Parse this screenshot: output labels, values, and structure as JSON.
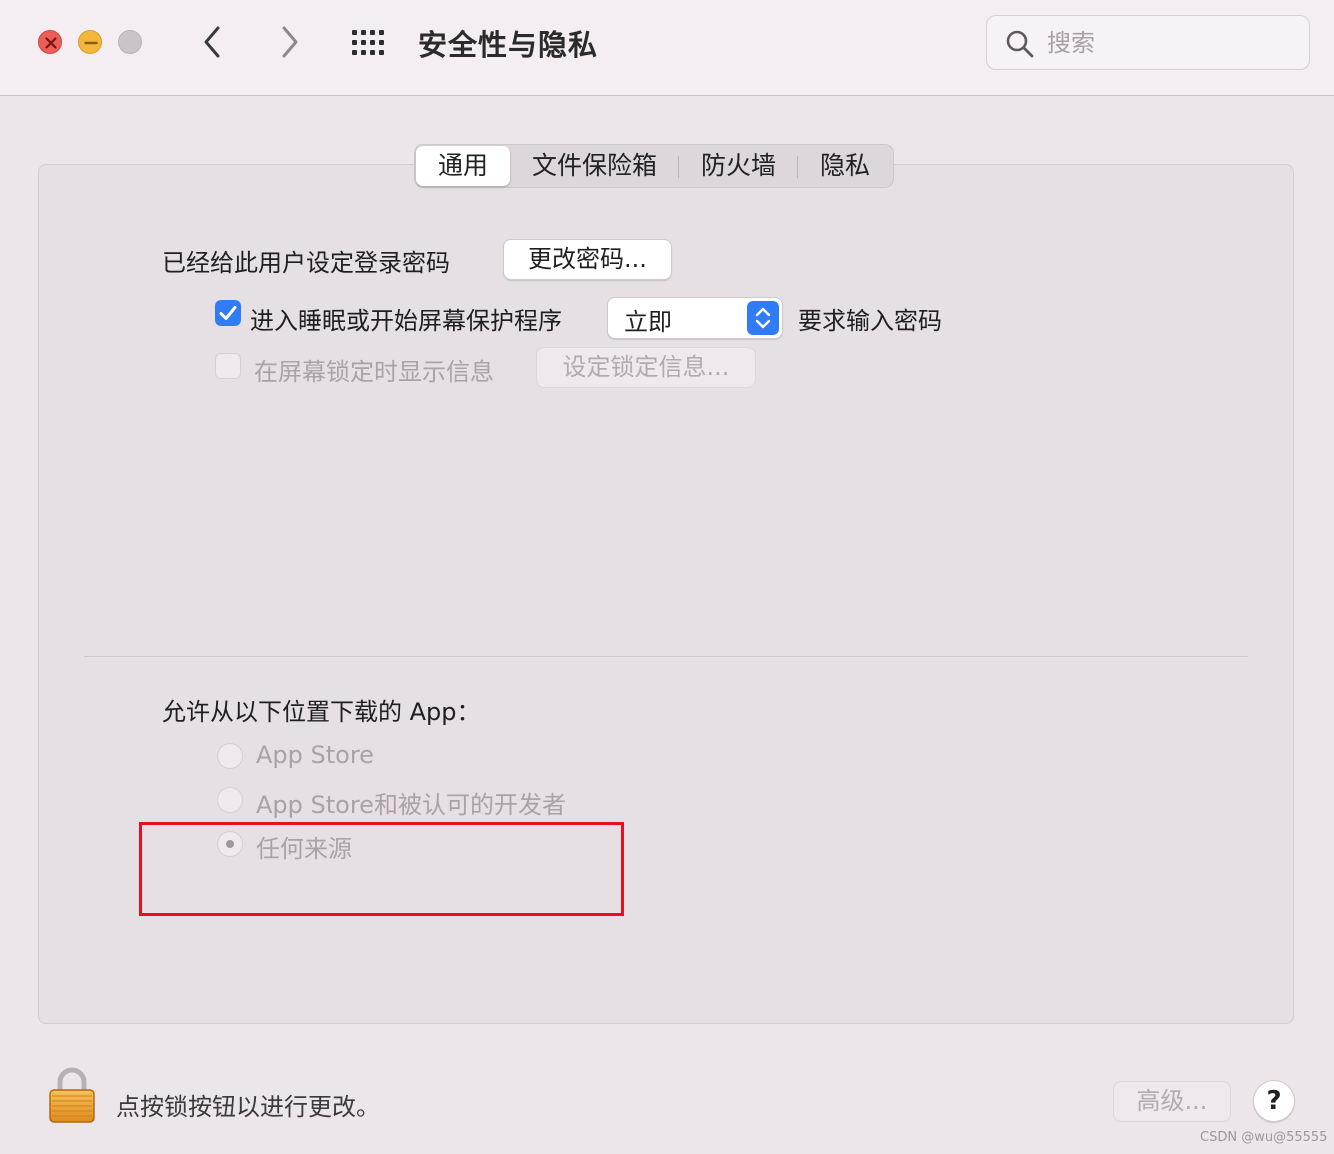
{
  "window": {
    "title": "安全性与隐私",
    "search_placeholder": "搜索"
  },
  "tabs": [
    {
      "label": "通用",
      "active": true
    },
    {
      "label": "文件保险箱",
      "active": false
    },
    {
      "label": "防火墙",
      "active": false
    },
    {
      "label": "隐私",
      "active": false
    }
  ],
  "general": {
    "password_set_label": "已经给此用户设定登录密码",
    "change_password_button": "更改密码...",
    "require_password": {
      "checked": true,
      "label_before": "进入睡眠或开始屏幕保护程序",
      "selected_option": "立即",
      "label_after": "要求输入密码"
    },
    "show_message": {
      "checked": false,
      "label": "在屏幕锁定时显示信息",
      "button": "设定锁定信息..."
    }
  },
  "downloads": {
    "heading": "允许从以下位置下载的 App：",
    "options": [
      {
        "label": "App Store",
        "selected": false
      },
      {
        "label": "App Store和被认可的开发者",
        "selected": false
      },
      {
        "label": "任何来源",
        "selected": true
      }
    ]
  },
  "footer": {
    "lock_text": "点按锁按钮以进行更改。",
    "advanced_button": "高级...",
    "help_button": "?"
  },
  "watermark": "CSDN @wu@55555",
  "colors": {
    "accent": "#2f7cf6",
    "highlight_box": "#e8101c"
  }
}
